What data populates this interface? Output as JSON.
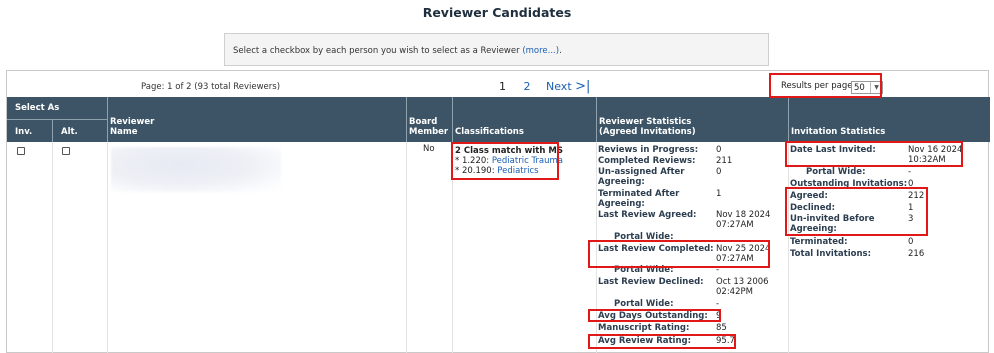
{
  "page": {
    "title": "Reviewer Candidates",
    "info_text": "Select a checkbox by each person you wish to select as a Reviewer ",
    "info_link": "(more...)",
    "info_end": "."
  },
  "pager": {
    "page_info": "Page: 1 of 2 (93 total Reviewers)",
    "current": "1",
    "other": "2",
    "next": "Next",
    "next_icon": ">|",
    "rpp_label": "Results per page",
    "rpp_value": "50"
  },
  "headers": {
    "select_as": "Select As",
    "inv": "Inv.",
    "alt": "Alt.",
    "reviewer_name_1": "Reviewer",
    "reviewer_name_2": "Name",
    "board_1": "Board",
    "board_2": "Member",
    "classifications": "Classifications",
    "stats_1": "Reviewer Statistics",
    "stats_2": "(Agreed Invitations)",
    "invitation": "Invitation Statistics"
  },
  "row": {
    "board_member": "No",
    "classifications": {
      "match": "2 Class match with MS",
      "items": [
        {
          "code": "* 1.220: ",
          "label": "Pediatric Trauma"
        },
        {
          "code": "* 20.190: ",
          "label": "Pediatrics"
        }
      ]
    },
    "reviewer_stats": [
      {
        "label": "Reviews in Progress:",
        "value": "0"
      },
      {
        "label": "Completed Reviews:",
        "value": "211"
      },
      {
        "label": "Un-assigned After",
        "value": "0"
      },
      {
        "label": "Agreeing:",
        "value": ""
      },
      {
        "label": "Terminated After",
        "value": "1"
      },
      {
        "label": "Agreeing:",
        "value": ""
      },
      {
        "label": "Last Review Agreed:",
        "value": "Nov 18 2024"
      },
      {
        "label": "",
        "value": "07:27AM"
      },
      {
        "label": "Portal Wide:",
        "value": ""
      },
      {
        "label": "Last Review Completed:",
        "value": "Nov 25 2024"
      },
      {
        "label": "",
        "value": "07:27AM"
      },
      {
        "label": "Portal Wide:",
        "value": "-"
      },
      {
        "label": "Last Review Declined:",
        "value": "Oct 13 2006"
      },
      {
        "label": "",
        "value": "02:42PM"
      },
      {
        "label": "Portal Wide:",
        "value": "-"
      },
      {
        "label": "Avg Days Outstanding:",
        "value": "9"
      },
      {
        "label": "Manuscript Rating:",
        "value": "85"
      },
      {
        "label": "Avg Review Rating:",
        "value": "95.7"
      }
    ],
    "invitation_stats": [
      {
        "label": "Date Last Invited:",
        "value": "Nov 16 2024"
      },
      {
        "label": "",
        "value": "10:32AM"
      },
      {
        "label": "Portal Wide:",
        "value": "-"
      },
      {
        "label": "Outstanding Invitations:",
        "value": "0"
      },
      {
        "label": "Agreed:",
        "value": "212"
      },
      {
        "label": "Declined:",
        "value": "1"
      },
      {
        "label": "Un-invited Before",
        "value": "3"
      },
      {
        "label": "Agreeing:",
        "value": ""
      },
      {
        "label": "Terminated:",
        "value": "0"
      },
      {
        "label": "Total Invitations:",
        "value": "216"
      }
    ]
  },
  "colors": {
    "header_bg": "#3c5466",
    "link": "#1a5fb4",
    "highlight": "#e01818"
  }
}
